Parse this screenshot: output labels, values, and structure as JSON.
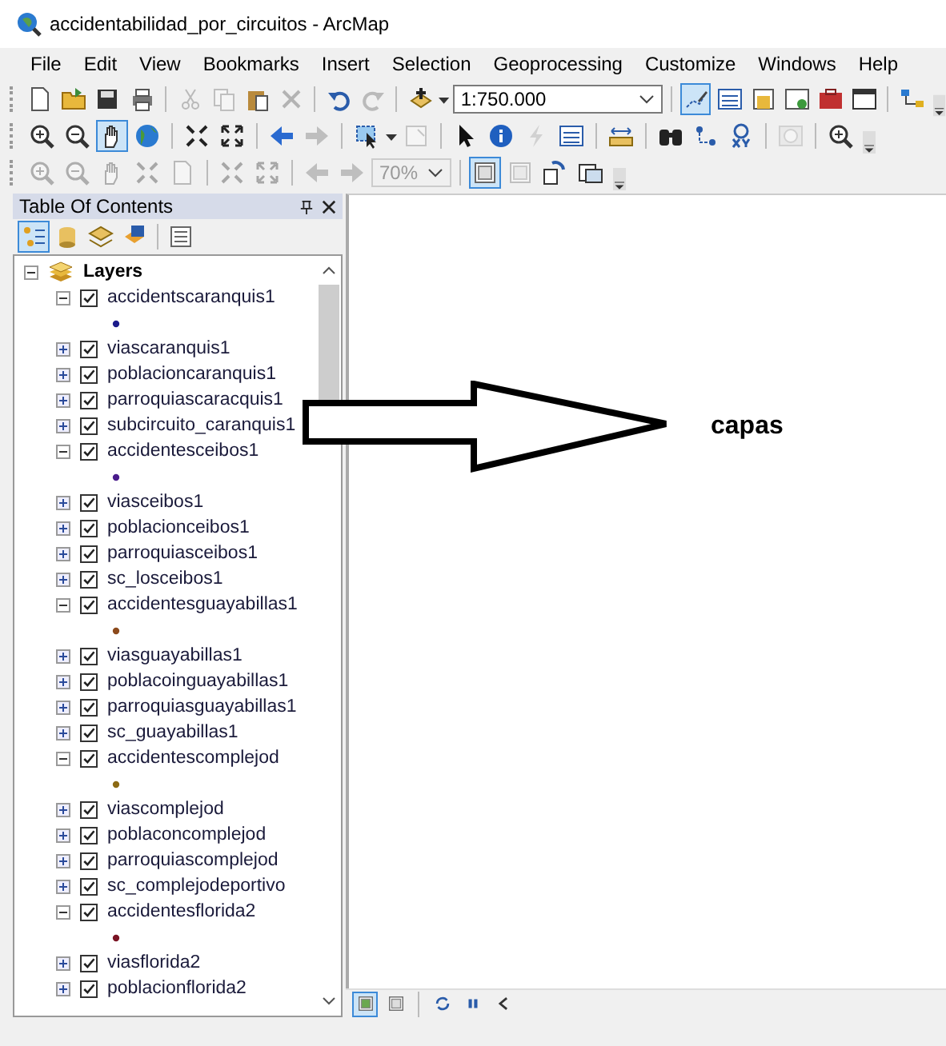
{
  "window": {
    "title": "accidentabilidad_por_circuitos - ArcMap"
  },
  "menu": [
    {
      "label": "File"
    },
    {
      "label": "Edit"
    },
    {
      "label": "View"
    },
    {
      "label": "Bookmarks"
    },
    {
      "label": "Insert"
    },
    {
      "label": "Selection"
    },
    {
      "label": "Geoprocessing"
    },
    {
      "label": "Customize"
    },
    {
      "label": "Windows"
    },
    {
      "label": "Help"
    }
  ],
  "toolbars": [
    {
      "tools": [
        {
          "disabled": false,
          "selected": false
        },
        {
          "disabled": false,
          "selected": false
        },
        {
          "disabled": false,
          "selected": false
        },
        {
          "disabled": false,
          "selected": false
        },
        {
          "disabled": true,
          "selected": false
        },
        {
          "disabled": true,
          "selected": false
        },
        {
          "disabled": false,
          "selected": false
        },
        {
          "disabled": true,
          "selected": false
        },
        {
          "disabled": false,
          "selected": false
        },
        {
          "disabled": true,
          "selected": false
        },
        {
          "disabled": false,
          "selected": false
        },
        {
          "disabled": false,
          "selected": true
        },
        {
          "disabled": false,
          "selected": false
        },
        {
          "disabled": false,
          "selected": false
        },
        {
          "disabled": false,
          "selected": false
        },
        {
          "disabled": false,
          "selected": false
        },
        {
          "disabled": false,
          "selected": false
        },
        {
          "disabled": false,
          "selected": false
        }
      ],
      "field": {
        "value": "1:750.000",
        "disabled": false
      }
    },
    {
      "tools": [
        {
          "disabled": false,
          "selected": false
        },
        {
          "disabled": false,
          "selected": false
        },
        {
          "disabled": false,
          "selected": true
        },
        {
          "disabled": false,
          "selected": false
        },
        {
          "disabled": false,
          "selected": false
        },
        {
          "disabled": false,
          "selected": false
        },
        {
          "disabled": false,
          "selected": false
        },
        {
          "disabled": true,
          "selected": false
        },
        {
          "disabled": false,
          "selected": false
        },
        {
          "disabled": true,
          "selected": false
        },
        {
          "disabled": false,
          "selected": false
        },
        {
          "disabled": false,
          "selected": false
        },
        {
          "disabled": true,
          "selected": false
        },
        {
          "disabled": false,
          "selected": false
        },
        {
          "disabled": false,
          "selected": false
        },
        {
          "disabled": false,
          "selected": false
        },
        {
          "disabled": false,
          "selected": false
        },
        {
          "disabled": false,
          "selected": false
        },
        {
          "disabled": true,
          "selected": false
        },
        {
          "disabled": false,
          "selected": false
        }
      ]
    },
    {
      "tools": [
        {
          "disabled": true,
          "selected": false
        },
        {
          "disabled": true,
          "selected": false
        },
        {
          "disabled": true,
          "selected": false
        },
        {
          "disabled": true,
          "selected": false
        },
        {
          "disabled": true,
          "selected": false
        },
        {
          "disabled": true,
          "selected": false
        },
        {
          "disabled": true,
          "selected": false
        },
        {
          "disabled": true,
          "selected": false
        },
        {
          "disabled": true,
          "selected": false
        },
        {
          "disabled": false,
          "selected": true
        },
        {
          "disabled": true,
          "selected": false
        },
        {
          "disabled": false,
          "selected": false
        },
        {
          "disabled": false,
          "selected": false
        }
      ],
      "field": {
        "value": "70%",
        "disabled": true
      }
    }
  ],
  "toc": {
    "title": "Table Of Contents",
    "tabs": [
      {
        "selected": true
      },
      {
        "selected": false
      },
      {
        "selected": false
      },
      {
        "selected": false
      },
      {
        "selected": false
      }
    ],
    "root": {
      "label": "Layers",
      "expanded": true,
      "children": [
        {
          "label": "accidentscaranquis1",
          "checked": true,
          "expanded": true,
          "children": [
            {
              "kind": "symbol",
              "color": "#1c1c8c"
            }
          ]
        },
        {
          "label": "viascaranquis1",
          "checked": true,
          "expanded": false
        },
        {
          "label": "poblacioncaranquis1",
          "checked": true,
          "expanded": false
        },
        {
          "label": "parroquiascaracquis1",
          "checked": true,
          "expanded": false
        },
        {
          "label": "subcircuito_caranquis1",
          "checked": true,
          "expanded": false
        },
        {
          "label": "accidentesceibos1",
          "checked": true,
          "expanded": true,
          "children": [
            {
              "kind": "symbol",
              "color": "#4a1c8c"
            }
          ]
        },
        {
          "label": "viasceibos1",
          "checked": true,
          "expanded": false
        },
        {
          "label": "poblacionceibos1",
          "checked": true,
          "expanded": false
        },
        {
          "label": "parroquiasceibos1",
          "checked": true,
          "expanded": false
        },
        {
          "label": "sc_losceibos1",
          "checked": true,
          "expanded": false
        },
        {
          "label": "accidentesguayabillas1",
          "checked": true,
          "expanded": true,
          "children": [
            {
              "kind": "symbol",
              "color": "#8c4a1c"
            }
          ]
        },
        {
          "label": "viasguayabillas1",
          "checked": true,
          "expanded": false
        },
        {
          "label": "poblacoinguayabillas1",
          "checked": true,
          "expanded": false
        },
        {
          "label": "parroquiasguayabillas1",
          "checked": true,
          "expanded": false
        },
        {
          "label": "sc_guayabillas1",
          "checked": true,
          "expanded": false
        },
        {
          "label": "accidentescomplejod",
          "checked": true,
          "expanded": true,
          "children": [
            {
              "kind": "symbol",
              "color": "#8c6a14"
            }
          ]
        },
        {
          "label": "viascomplejod",
          "checked": true,
          "expanded": false
        },
        {
          "label": "poblaconcomplejod",
          "checked": true,
          "expanded": false
        },
        {
          "label": "parroquiascomplejod",
          "checked": true,
          "expanded": false
        },
        {
          "label": "sc_complejodeportivo",
          "checked": true,
          "expanded": false
        },
        {
          "label": "accidentesflorida2",
          "checked": true,
          "expanded": true,
          "children": [
            {
              "kind": "symbol",
              "color": "#7a1424"
            }
          ]
        },
        {
          "label": "viasflorida2",
          "checked": true,
          "expanded": false
        },
        {
          "label": "poblacionflorida2",
          "checked": true,
          "expanded": false
        }
      ]
    }
  },
  "view_bar": {
    "tools": [
      {
        "selected": true
      },
      {
        "selected": false
      },
      {
        "selected": false
      },
      {
        "selected": false
      },
      {
        "selected": false
      }
    ]
  },
  "annotation": {
    "label": "capas"
  }
}
